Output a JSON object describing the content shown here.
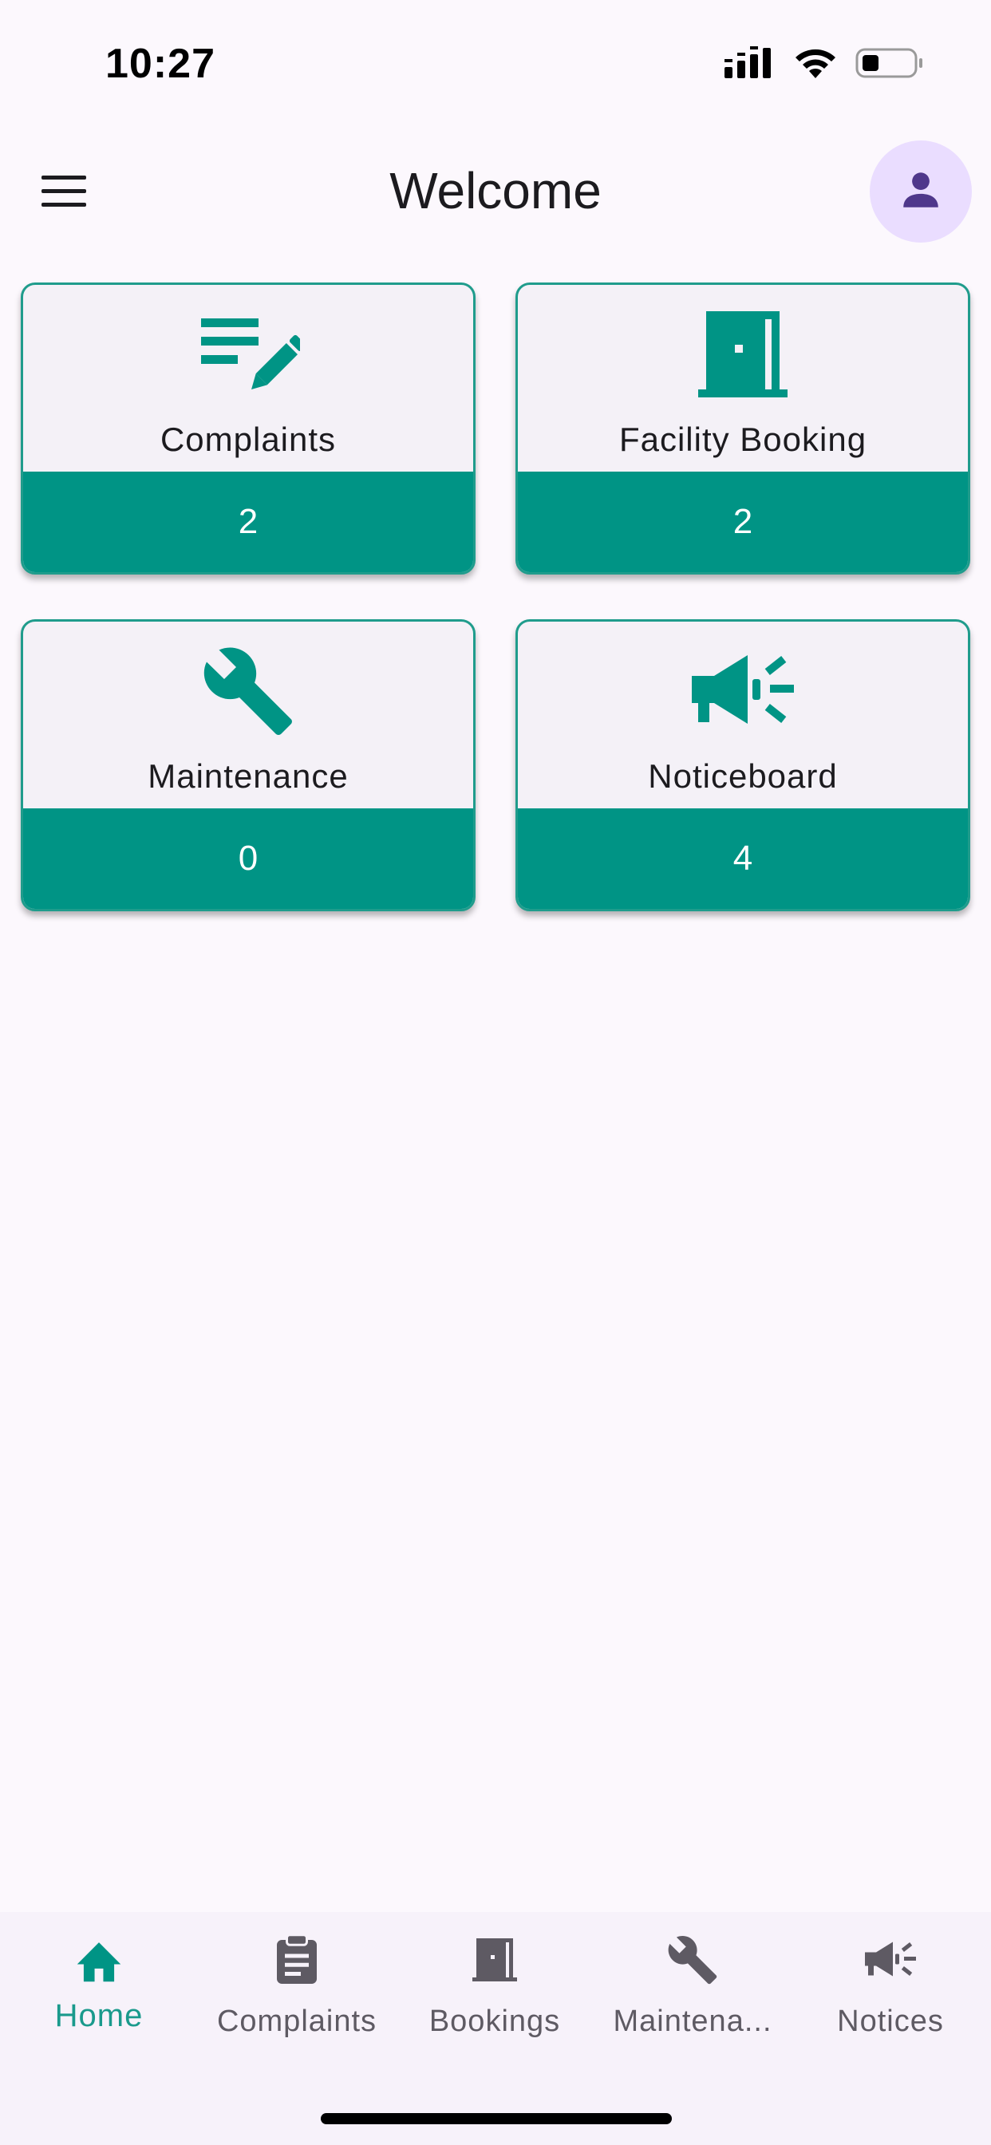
{
  "status_bar": {
    "time": "10:27",
    "icons": [
      "cellular-signal-icon",
      "wifi-icon",
      "battery-icon"
    ]
  },
  "app_bar": {
    "title": "Welcome",
    "menu_icon": "hamburger-menu-icon",
    "profile_icon": "person-icon"
  },
  "cards": [
    {
      "label": "Complaints",
      "count": "2",
      "icon": "edit-note-icon"
    },
    {
      "label": "Facility Booking",
      "count": "2",
      "icon": "door-icon"
    },
    {
      "label": "Maintenance",
      "count": "0",
      "icon": "wrench-icon"
    },
    {
      "label": "Noticeboard",
      "count": "4",
      "icon": "megaphone-icon"
    }
  ],
  "bottom_nav": [
    {
      "label": "Home",
      "icon": "home-icon",
      "active": true
    },
    {
      "label": "Complaints",
      "icon": "clipboard-icon",
      "active": false
    },
    {
      "label": "Bookings",
      "icon": "door-icon",
      "active": false
    },
    {
      "label": "Maintena...",
      "icon": "wrench-icon",
      "active": false
    },
    {
      "label": "Notices",
      "icon": "megaphone-icon",
      "active": false
    }
  ],
  "colors": {
    "accent": "#009485",
    "card_border": "#1f9c8c",
    "background": "#fcf8fd",
    "avatar_bg": "#eaddff",
    "avatar_icon": "#4f378b",
    "nav_inactive": "#5e5a63"
  }
}
